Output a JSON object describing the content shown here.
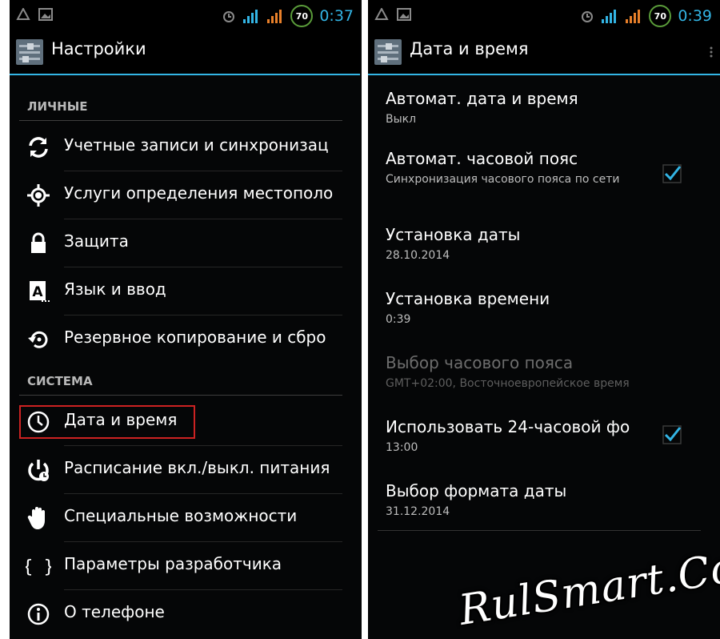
{
  "left": {
    "time": "0:37",
    "battery": "70",
    "title": "Настройки",
    "sections": {
      "personal": "ЛИЧНЫЕ",
      "system": "СИСТЕМА"
    },
    "items": [
      {
        "label": "Учетные записи и синхронизац",
        "icon": "sync-icon"
      },
      {
        "label": "Услуги определения местополо",
        "icon": "location-icon"
      },
      {
        "label": "Защита",
        "icon": "lock-icon"
      },
      {
        "label": "Язык и ввод",
        "icon": "keyboard-language-icon"
      },
      {
        "label": "Резервное копирование и сбро",
        "icon": "backup-restore-icon"
      },
      {
        "label": "Дата и время",
        "icon": "clock-icon"
      },
      {
        "label": "Расписание вкл./выкл. питания",
        "icon": "power-schedule-icon"
      },
      {
        "label": "Специальные возможности",
        "icon": "hand-icon"
      },
      {
        "label": "Параметры разработчика",
        "icon": "braces-icon"
      },
      {
        "label": "О телефоне",
        "icon": "info-icon"
      }
    ]
  },
  "right": {
    "time": "0:39",
    "battery": "70",
    "title": "Дата и время",
    "prefs": [
      {
        "title": "Автомат. дата и время",
        "summary": "Выкл"
      },
      {
        "title": "Автомат. часовой пояс",
        "summary": "Синхронизация часового пояса по сети",
        "checked": true
      },
      {
        "title": "Установка даты",
        "summary": "28.10.2014"
      },
      {
        "title": "Установка времени",
        "summary": "0:39"
      },
      {
        "title": "Выбор часового пояса",
        "summary": "GMT+02:00, Восточноевропейское время",
        "disabled": true
      },
      {
        "title": "Использовать 24-часовой фо",
        "summary": "13:00",
        "checked": true
      },
      {
        "title": "Выбор формата даты",
        "summary": "31.12.2014"
      }
    ]
  },
  "watermark": "RulSmart.Com",
  "colors": {
    "accent": "#33b5e5",
    "highlight": "#cc2222",
    "background": "#050607"
  }
}
